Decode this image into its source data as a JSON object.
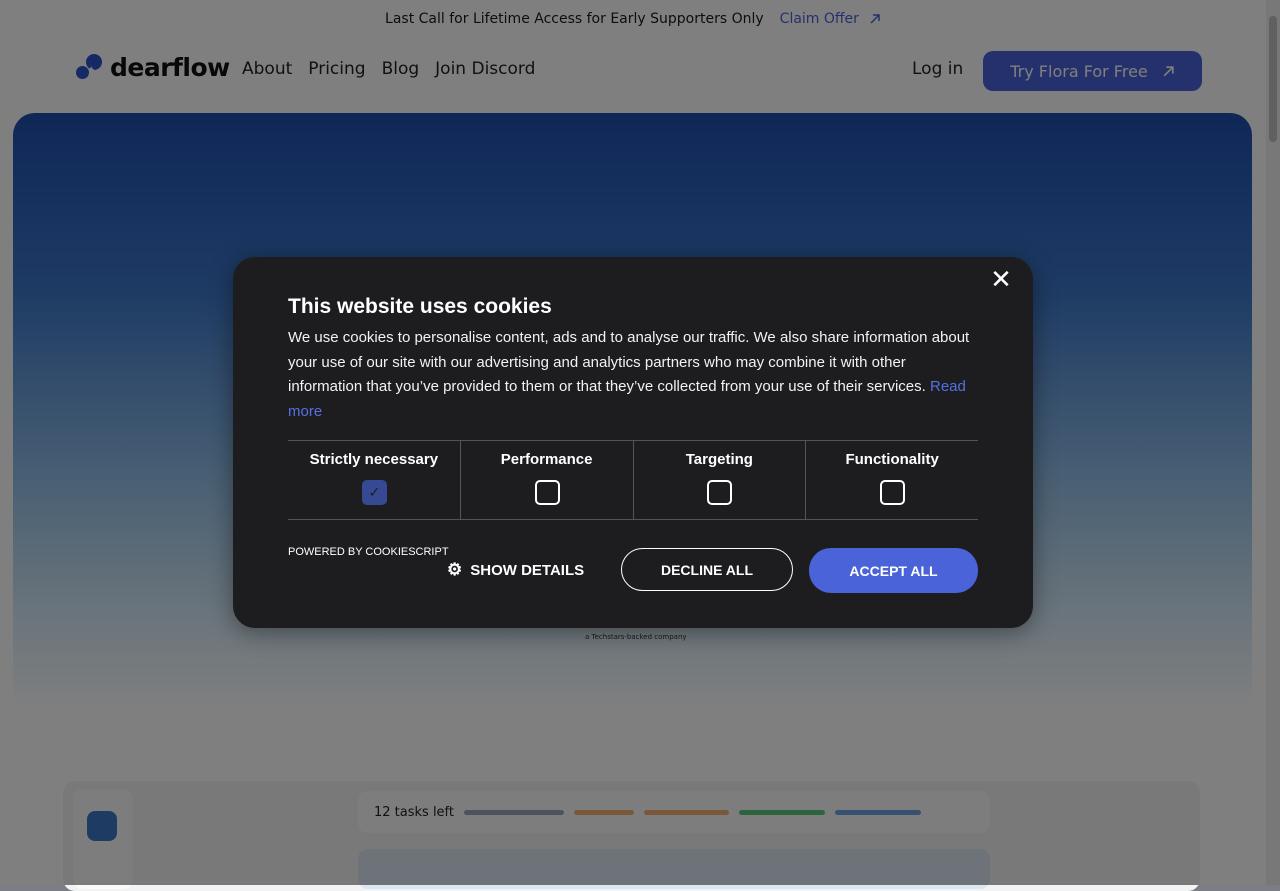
{
  "announcement": {
    "text": "Last Call for Lifetime Access for Early Supporters Only",
    "link_label": "Claim Offer",
    "link_icon": "arrow-up-right-icon"
  },
  "nav": {
    "logo_text": "dearflow",
    "links": [
      "About",
      "Pricing",
      "Blog",
      "Join Discord"
    ],
    "login_label": "Log in",
    "cta_label": "Try Flora For Free",
    "cta_icon": "arrow-up-right-icon"
  },
  "hero": {
    "techstars_text": "a Techstars-backed company"
  },
  "app_preview": {
    "tasks_label": "12 tasks left",
    "badge_count": "12"
  },
  "cookie_dialog": {
    "title": "This website uses cookies",
    "body": "We use cookies to personalise content, ads and to analyse our traffic. We also share information about your use of our site with our advertising and analytics partners who may combine it with other information that you’ve provided to them or that they’ve collected from your use of their services.",
    "read_more": "Read more",
    "categories": [
      {
        "label": "Strictly necessary",
        "checked": true
      },
      {
        "label": "Performance",
        "checked": false
      },
      {
        "label": "Targeting",
        "checked": false
      },
      {
        "label": "Functionality",
        "checked": false
      }
    ],
    "powered_by": "POWERED BY COOKIESCRIPT",
    "show_details": "SHOW DETAILS",
    "decline_label": "DECLINE ALL",
    "accept_label": "ACCEPT ALL",
    "accent_color": "#4a63d9"
  }
}
